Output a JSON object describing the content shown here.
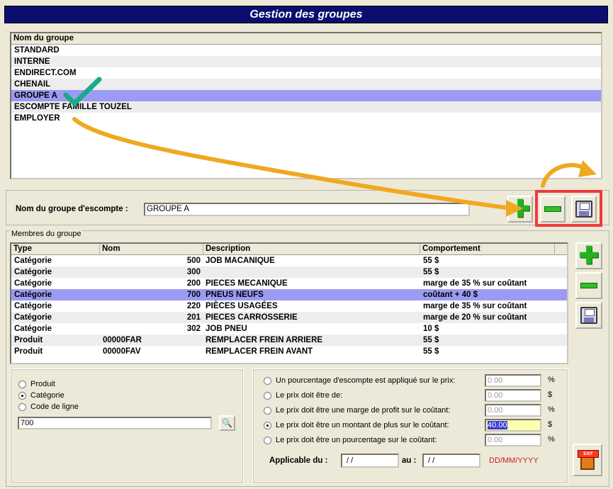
{
  "window": {
    "title": "Gestion des groupes"
  },
  "groups": {
    "header": "Nom du groupe",
    "items": [
      "STANDARD",
      "INTERNE",
      "ENDIRECT.COM",
      "CHENAIL",
      "GROUPE A",
      "ESCOMPTE FAMILLE TOUZEL",
      "EMPLOYER"
    ],
    "selected_index": 4
  },
  "group_name": {
    "label": "Nom du groupe d'escompte :",
    "value": "GROUPE A"
  },
  "members": {
    "caption": "Membres du groupe",
    "columns": [
      "Type",
      "Nom",
      "Description",
      "Comportement"
    ],
    "rows": [
      {
        "type": "Catégorie",
        "nom": "500",
        "description": "JOB MACANIQUE",
        "comportement": "55 $"
      },
      {
        "type": "Catégorie",
        "nom": "300",
        "description": "",
        "comportement": "55 $"
      },
      {
        "type": "Catégorie",
        "nom": "200",
        "description": "PIECES MECANIQUE",
        "comportement": "marge de 35 % sur coûtant"
      },
      {
        "type": "Catégorie",
        "nom": "700",
        "description": "PNEUS NEUFS",
        "comportement": "coûtant + 40 $"
      },
      {
        "type": "Catégorie",
        "nom": "220",
        "description": "PIÈCES USAGÉES",
        "comportement": "marge de 35 % sur coûtant"
      },
      {
        "type": "Catégorie",
        "nom": "201",
        "description": "PIECES CARROSSERIE",
        "comportement": "marge de 20 % sur coûtant"
      },
      {
        "type": "Catégorie",
        "nom": "302",
        "description": "JOB PNEU",
        "comportement": "10 $"
      },
      {
        "type": "Produit",
        "nom": "00000FAR",
        "description": "REMPLACER FREIN ARRIERE",
        "comportement": "55 $"
      },
      {
        "type": "Produit",
        "nom": "00000FAV",
        "description": "REMPLACER FREIN AVANT",
        "comportement": "55 $"
      }
    ],
    "selected_index": 3
  },
  "type_options": {
    "items": [
      "Produit",
      "Catégorie",
      "Code de ligne"
    ],
    "selected_index": 1,
    "code_value": "700"
  },
  "discount_options": {
    "items": [
      {
        "label": "Un pourcentage d'escompte est appliqué sur le prix:",
        "value": "0.00",
        "unit": "%"
      },
      {
        "label": "Le prix doit être de:",
        "value": "0.00",
        "unit": "$"
      },
      {
        "label": "Le prix doit être une marge de profit sur le coûtant:",
        "value": "0.00",
        "unit": "%"
      },
      {
        "label": "Le prix doit être un montant de plus sur le coûtant:",
        "value": "40.00",
        "unit": "$"
      },
      {
        "label": "Le prix doit être un pourcentage sur le coûtant:",
        "value": "0.00",
        "unit": "%"
      }
    ],
    "selected_index": 3
  },
  "applicable": {
    "label": "Applicable du :",
    "from": "/ /",
    "au_label": "au :",
    "to": "/ /",
    "format_hint": "DD/MM/YYYY"
  },
  "exit_button": {
    "label": "EXIT"
  },
  "colors": {
    "title_bg": "#0a0e6e",
    "selection": "#9b9bf3",
    "highlight_box": "#ee3b3b",
    "arrow": "#f0a820",
    "check": "#1aaa88"
  }
}
